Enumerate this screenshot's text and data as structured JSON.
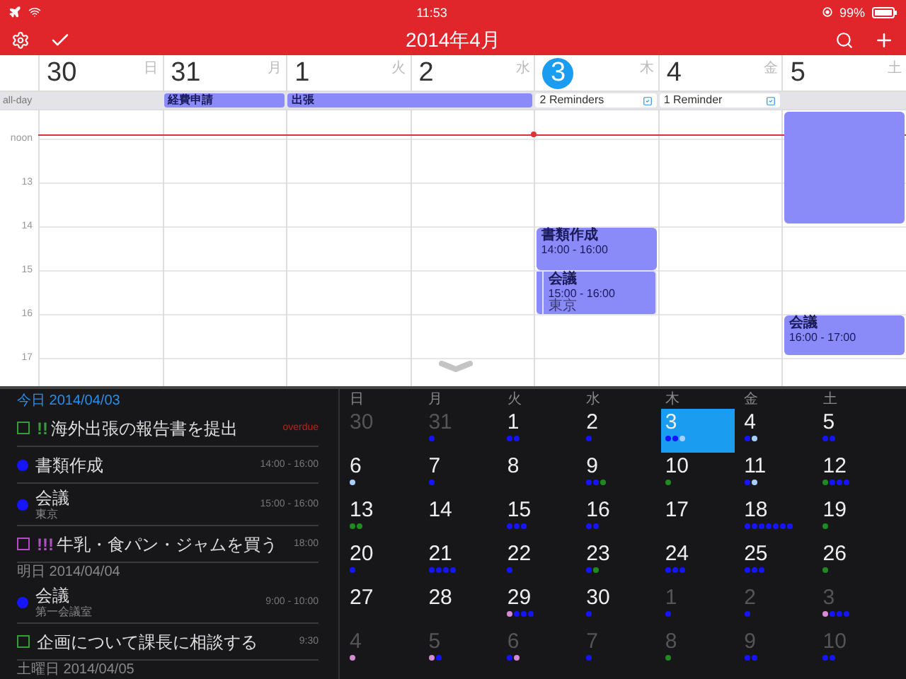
{
  "status_bar": {
    "time": "11:53",
    "battery": "99%"
  },
  "toolbar": {
    "title": "2014年4月"
  },
  "week": {
    "days": [
      {
        "number": "30",
        "weekday": "日",
        "selected": false
      },
      {
        "number": "31",
        "weekday": "月",
        "selected": false
      },
      {
        "number": "1",
        "weekday": "火",
        "selected": false
      },
      {
        "number": "2",
        "weekday": "水",
        "selected": false
      },
      {
        "number": "3",
        "weekday": "木",
        "selected": true,
        "events": [
          {
            "kind": "normal",
            "title": "書類作成",
            "time": "14:00 - 16:00"
          },
          {
            "kind": "inset",
            "title": "会議",
            "time": "15:00 - 16:00",
            "location": "東京"
          }
        ]
      },
      {
        "number": "4",
        "weekday": "金",
        "selected": false
      },
      {
        "number": "5",
        "weekday": "土",
        "selected": false,
        "events": [
          {
            "kind": "untitled"
          },
          {
            "kind": "normal",
            "title": "会議",
            "time": "16:00 - 17:00"
          }
        ]
      }
    ]
  },
  "all_day": {
    "label": "all-day",
    "cells": [
      {
        "kind": "empty"
      },
      {
        "kind": "event",
        "title": "経費申請"
      },
      {
        "kind": "event",
        "title": "出張"
      },
      {
        "kind": "continuation"
      },
      {
        "kind": "reminder",
        "title": "2 Reminders"
      },
      {
        "kind": "reminder",
        "title": "1 Reminder"
      },
      {
        "kind": "empty"
      }
    ]
  },
  "timeline": {
    "hours": [
      "noon",
      "13",
      "14",
      "15",
      "16",
      "17"
    ]
  },
  "agenda": {
    "sections": [
      {
        "heading": "今日 2014/04/03",
        "today": true,
        "items": [
          {
            "kind": "task",
            "color": "#3a9a3a",
            "priority": "!!",
            "title": "海外出張の報告書を提出",
            "time": "overdue",
            "overdue": true
          },
          {
            "kind": "event",
            "color": "#1414ff",
            "title": "書類作成",
            "time": "14:00 - 16:00",
            "overdue": false
          },
          {
            "kind": "event",
            "color": "#1414ff",
            "title": "会議",
            "location": "東京",
            "time": "15:00 - 16:00",
            "overdue": false
          },
          {
            "kind": "task",
            "color": "#b050c0",
            "priority": "!!!",
            "title": "牛乳・食パン・ジャムを買う",
            "time": "18:00",
            "overdue": false
          }
        ]
      },
      {
        "heading": "明日 2014/04/04",
        "today": false,
        "items": [
          {
            "kind": "event",
            "color": "#1414ff",
            "title": "会議",
            "location": "第一会議室",
            "time": "9:00 - 10:00",
            "overdue": false
          },
          {
            "kind": "task",
            "color": "#3a9a3a",
            "title": "企画について課長に相談する",
            "time": "9:30",
            "overdue": false
          }
        ]
      },
      {
        "heading": "土曜日 2014/04/05",
        "today": false
      }
    ]
  },
  "month": {
    "weekdays": [
      "日",
      "月",
      "火",
      "水",
      "木",
      "金",
      "土"
    ],
    "days": [
      {
        "number": "30",
        "muted": true,
        "selected": false
      },
      {
        "number": "31",
        "muted": true,
        "selected": false,
        "dots": [
          {
            "color": "#1414ff"
          }
        ]
      },
      {
        "number": "1",
        "muted": false,
        "selected": false,
        "dots": [
          {
            "color": "#1414ff"
          },
          {
            "color": "#1414ff"
          }
        ]
      },
      {
        "number": "2",
        "muted": false,
        "selected": false,
        "dots": [
          {
            "color": "#1414ff"
          }
        ]
      },
      {
        "number": "3",
        "muted": false,
        "selected": true,
        "dots": [
          {
            "color": "#1414ff"
          },
          {
            "color": "#1414ff"
          },
          {
            "color": "#a8d0ff"
          }
        ]
      },
      {
        "number": "4",
        "muted": false,
        "selected": false,
        "dots": [
          {
            "color": "#1414ff"
          },
          {
            "color": "#a8d0ff"
          }
        ]
      },
      {
        "number": "5",
        "muted": false,
        "selected": false,
        "dots": [
          {
            "color": "#1414ff"
          },
          {
            "color": "#1414ff"
          }
        ]
      },
      {
        "number": "6",
        "muted": false,
        "selected": false,
        "dots": [
          {
            "color": "#a8d0ff"
          }
        ]
      },
      {
        "number": "7",
        "muted": false,
        "selected": false,
        "dots": [
          {
            "color": "#1414ff"
          }
        ]
      },
      {
        "number": "8",
        "muted": false,
        "selected": false
      },
      {
        "number": "9",
        "muted": false,
        "selected": false,
        "dots": [
          {
            "color": "#1414ff"
          },
          {
            "color": "#1414ff"
          },
          {
            "color": "#1f8a1f"
          }
        ]
      },
      {
        "number": "10",
        "muted": false,
        "selected": false,
        "dots": [
          {
            "color": "#1f8a1f"
          }
        ]
      },
      {
        "number": "11",
        "muted": false,
        "selected": false,
        "dots": [
          {
            "color": "#1414ff"
          },
          {
            "color": "#a8d0ff"
          }
        ]
      },
      {
        "number": "12",
        "muted": false,
        "selected": false,
        "dots": [
          {
            "color": "#1f8a1f"
          },
          {
            "color": "#1414ff"
          },
          {
            "color": "#1414ff"
          },
          {
            "color": "#1414ff"
          }
        ]
      },
      {
        "number": "13",
        "muted": false,
        "selected": false,
        "dots": [
          {
            "color": "#1f8a1f"
          },
          {
            "color": "#1f8a1f"
          }
        ]
      },
      {
        "number": "14",
        "muted": false,
        "selected": false
      },
      {
        "number": "15",
        "muted": false,
        "selected": false,
        "dots": [
          {
            "color": "#1414ff"
          },
          {
            "color": "#1414ff"
          },
          {
            "color": "#1414ff"
          }
        ]
      },
      {
        "number": "16",
        "muted": false,
        "selected": false,
        "dots": [
          {
            "color": "#1414ff"
          },
          {
            "color": "#1414ff"
          }
        ]
      },
      {
        "number": "17",
        "muted": false,
        "selected": false
      },
      {
        "number": "18",
        "muted": false,
        "selected": false,
        "dots": [
          {
            "color": "#1414ff"
          },
          {
            "color": "#1414ff"
          },
          {
            "color": "#1414ff"
          },
          {
            "color": "#1414ff"
          },
          {
            "color": "#1414ff"
          },
          {
            "color": "#1414ff"
          },
          {
            "color": "#1414ff"
          }
        ]
      },
      {
        "number": "19",
        "muted": false,
        "selected": false,
        "dots": [
          {
            "color": "#1f8a1f"
          }
        ]
      },
      {
        "number": "20",
        "muted": false,
        "selected": false,
        "dots": [
          {
            "color": "#1414ff"
          }
        ]
      },
      {
        "number": "21",
        "muted": false,
        "selected": false,
        "dots": [
          {
            "color": "#1414ff"
          },
          {
            "color": "#1414ff"
          },
          {
            "color": "#1414ff"
          },
          {
            "color": "#1414ff"
          }
        ]
      },
      {
        "number": "22",
        "muted": false,
        "selected": false,
        "dots": [
          {
            "color": "#1414ff"
          }
        ]
      },
      {
        "number": "23",
        "muted": false,
        "selected": false,
        "dots": [
          {
            "color": "#1414ff"
          },
          {
            "color": "#1f8a1f"
          }
        ]
      },
      {
        "number": "24",
        "muted": false,
        "selected": false,
        "dots": [
          {
            "color": "#1414ff"
          },
          {
            "color": "#1414ff"
          },
          {
            "color": "#1414ff"
          }
        ]
      },
      {
        "number": "25",
        "muted": false,
        "selected": false,
        "dots": [
          {
            "color": "#1414ff"
          },
          {
            "color": "#1414ff"
          },
          {
            "color": "#1414ff"
          }
        ]
      },
      {
        "number": "26",
        "muted": false,
        "selected": false,
        "dots": [
          {
            "color": "#1f8a1f"
          }
        ]
      },
      {
        "number": "27",
        "muted": false,
        "selected": false
      },
      {
        "number": "28",
        "muted": false,
        "selected": false
      },
      {
        "number": "29",
        "muted": false,
        "selected": false,
        "dots": [
          {
            "color": "#d68ad6"
          },
          {
            "color": "#1414ff"
          },
          {
            "color": "#1414ff"
          },
          {
            "color": "#1414ff"
          }
        ]
      },
      {
        "number": "30",
        "muted": false,
        "selected": false,
        "dots": [
          {
            "color": "#1414ff"
          }
        ]
      },
      {
        "number": "1",
        "muted": true,
        "selected": false,
        "dots": [
          {
            "color": "#1414ff"
          }
        ]
      },
      {
        "number": "2",
        "muted": true,
        "selected": false,
        "dots": [
          {
            "color": "#1414ff"
          }
        ]
      },
      {
        "number": "3",
        "muted": true,
        "selected": false,
        "dots": [
          {
            "color": "#d68ad6"
          },
          {
            "color": "#1414ff"
          },
          {
            "color": "#1414ff"
          },
          {
            "color": "#1414ff"
          }
        ]
      },
      {
        "number": "4",
        "muted": true,
        "selected": false,
        "dots": [
          {
            "color": "#d68ad6"
          }
        ]
      },
      {
        "number": "5",
        "muted": true,
        "selected": false,
        "dots": [
          {
            "color": "#d68ad6"
          },
          {
            "color": "#1414ff"
          }
        ]
      },
      {
        "number": "6",
        "muted": true,
        "selected": false,
        "dots": [
          {
            "color": "#1414ff"
          },
          {
            "color": "#d68ad6"
          }
        ]
      },
      {
        "number": "7",
        "muted": true,
        "selected": false,
        "dots": [
          {
            "color": "#1414ff"
          }
        ]
      },
      {
        "number": "8",
        "muted": true,
        "selected": false,
        "dots": [
          {
            "color": "#1f8a1f"
          }
        ]
      },
      {
        "number": "9",
        "muted": true,
        "selected": false,
        "dots": [
          {
            "color": "#1414ff"
          },
          {
            "color": "#1414ff"
          }
        ]
      },
      {
        "number": "10",
        "muted": true,
        "selected": false,
        "dots": [
          {
            "color": "#1414ff"
          },
          {
            "color": "#1414ff"
          }
        ]
      }
    ]
  }
}
